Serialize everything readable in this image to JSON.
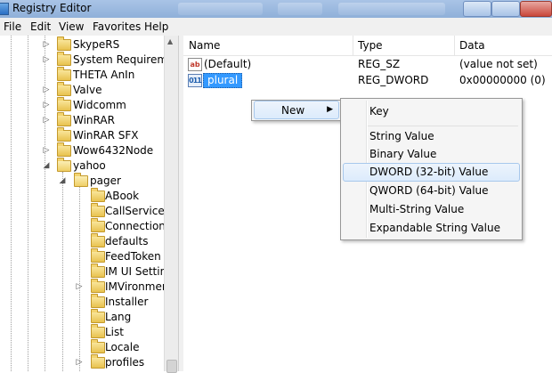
{
  "window": {
    "title": "Registry Editor"
  },
  "menubar": [
    "File",
    "Edit",
    "View",
    "Favorites",
    "Help"
  ],
  "tree": {
    "items": [
      {
        "label": "SkypeRS",
        "level": 0,
        "arrow": "▷",
        "open": false
      },
      {
        "label": "System Requirement",
        "level": 0,
        "arrow": "▷",
        "open": false
      },
      {
        "label": "THETA AnIn",
        "level": 0,
        "arrow": "",
        "open": false
      },
      {
        "label": "Valve",
        "level": 0,
        "arrow": "▷",
        "open": false
      },
      {
        "label": "Widcomm",
        "level": 0,
        "arrow": "▷",
        "open": false
      },
      {
        "label": "WinRAR",
        "level": 0,
        "arrow": "▷",
        "open": false
      },
      {
        "label": "WinRAR SFX",
        "level": 0,
        "arrow": "",
        "open": false
      },
      {
        "label": "Wow6432Node",
        "level": 0,
        "arrow": "▷",
        "open": false
      },
      {
        "label": "yahoo",
        "level": 0,
        "arrow": "◢",
        "open": true
      },
      {
        "label": "pager",
        "level": 1,
        "arrow": "◢",
        "open": true
      },
      {
        "label": "ABook",
        "level": 2,
        "arrow": "",
        "open": false
      },
      {
        "label": "CallService",
        "level": 2,
        "arrow": "",
        "open": false
      },
      {
        "label": "Connection",
        "level": 2,
        "arrow": "",
        "open": false
      },
      {
        "label": "defaults",
        "level": 2,
        "arrow": "",
        "open": false
      },
      {
        "label": "FeedToken",
        "level": 2,
        "arrow": "",
        "open": false
      },
      {
        "label": "IM UI Setting",
        "level": 2,
        "arrow": "",
        "open": false
      },
      {
        "label": "IMVironment",
        "level": 2,
        "arrow": "▷",
        "open": false
      },
      {
        "label": "Installer",
        "level": 2,
        "arrow": "",
        "open": false
      },
      {
        "label": "Lang",
        "level": 2,
        "arrow": "",
        "open": false
      },
      {
        "label": "List",
        "level": 2,
        "arrow": "",
        "open": false
      },
      {
        "label": "Locale",
        "level": 2,
        "arrow": "",
        "open": false
      },
      {
        "label": "profiles",
        "level": 2,
        "arrow": "▷",
        "open": false
      }
    ]
  },
  "list": {
    "columns": [
      "Name",
      "Type",
      "Data"
    ],
    "rows": [
      {
        "name": "(Default)",
        "type": "REG_SZ",
        "data": "(value not set)",
        "icon": "ab",
        "selected": false
      },
      {
        "name": "plural",
        "type": "REG_DWORD",
        "data": "0x00000000 (0)",
        "icon": "011",
        "selected": true
      }
    ]
  },
  "context_menu": {
    "new_label": "New",
    "submenu_arrow": "▶"
  },
  "submenu": {
    "items": [
      "Key",
      "String Value",
      "Binary Value",
      "DWORD (32-bit) Value",
      "QWORD (64-bit) Value",
      "Multi-String Value",
      "Expandable String Value"
    ],
    "highlighted": "DWORD (32-bit) Value"
  },
  "scrollbar": {
    "up_arrow": "▲"
  }
}
